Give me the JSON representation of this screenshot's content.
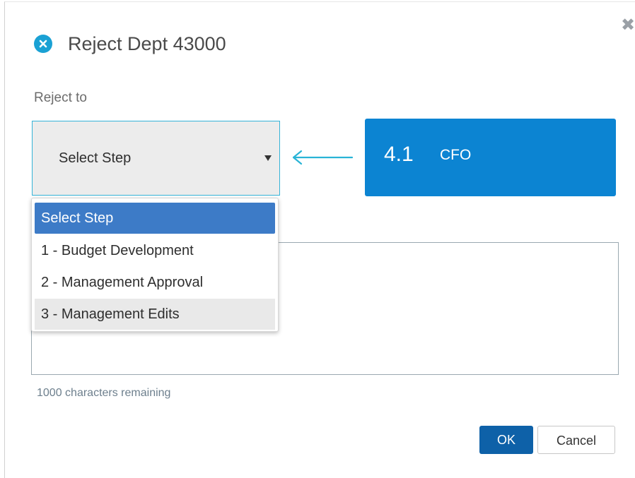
{
  "dialog": {
    "title": "Reject Dept 43000",
    "header_icon": "close-circle-icon",
    "close_icon": "close-x-icon"
  },
  "form": {
    "reject_to_label": "Reject to",
    "select_value": "Select Step",
    "options": [
      "Select Step",
      "1 - Budget Development",
      "2 - Management Approval",
      "3 - Management Edits"
    ],
    "characters_remaining": "1000 characters remaining"
  },
  "current_step": {
    "number": "4.1",
    "name": "CFO"
  },
  "buttons": {
    "ok": "OK",
    "cancel": "Cancel"
  },
  "colors": {
    "accent": "#1aa1d4",
    "step_box": "#0c84d2",
    "selected_option": "#3d7bc7",
    "ok_button": "#0e61a8"
  }
}
